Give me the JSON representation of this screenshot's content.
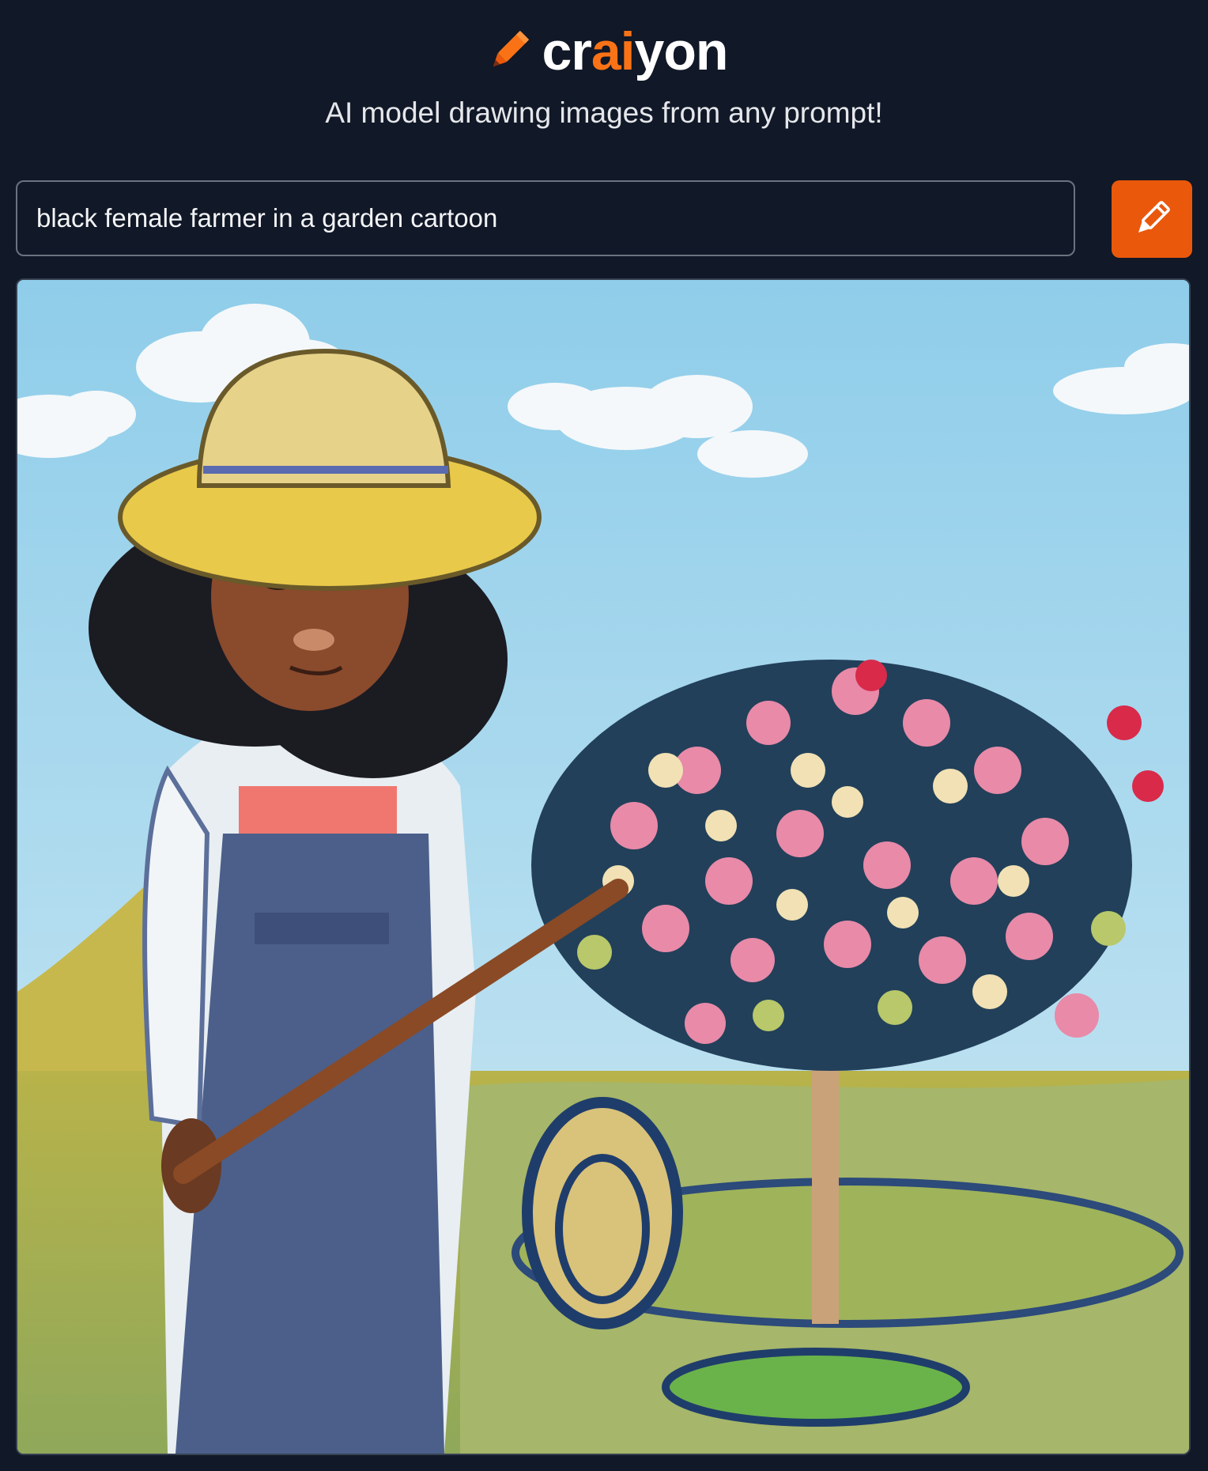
{
  "brand": {
    "prefix": "cr",
    "highlight": "ai",
    "suffix": "yon",
    "accent_color": "#f97316",
    "icon": "pencil-icon"
  },
  "tagline": "AI model drawing images from any prompt!",
  "prompt": {
    "value": "black female farmer in a garden cartoon"
  },
  "draw_button": {
    "icon": "pencil-icon",
    "color": "#ea580c"
  },
  "result": {
    "description_icon": "generated-image"
  }
}
